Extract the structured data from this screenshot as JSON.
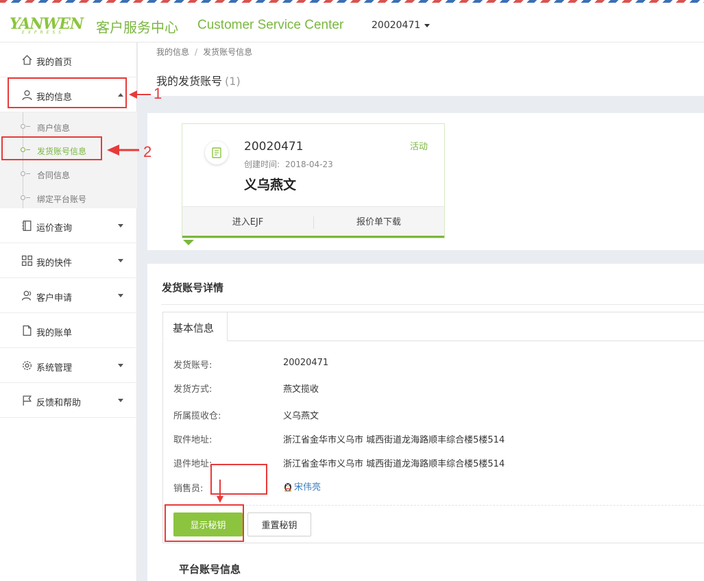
{
  "colors": {
    "brand_green": "#7ab73f",
    "button_green": "#8cc43f",
    "annotation_red": "#e83a3a",
    "link_blue": "#3b7dbf"
  },
  "header": {
    "logo_text": "YANWEN",
    "logo_subtext": "EXPRESS",
    "title_cn": "客户服务中心",
    "title_en": "Customer Service Center",
    "account_dropdown": "20020471"
  },
  "sidebar": {
    "items": [
      {
        "label": "我的首页",
        "icon": "home-icon"
      },
      {
        "label": "我的信息",
        "icon": "user-icon",
        "expanded": true
      },
      {
        "label": "运价查询",
        "icon": "notebook-icon"
      },
      {
        "label": "我的快件",
        "icon": "grid-icon"
      },
      {
        "label": "客户申请",
        "icon": "users-icon"
      },
      {
        "label": "我的账单",
        "icon": "document-icon"
      },
      {
        "label": "系统管理",
        "icon": "gear-icon"
      },
      {
        "label": "反馈和帮助",
        "icon": "flag-icon"
      }
    ],
    "submenu": [
      {
        "label": "商户信息"
      },
      {
        "label": "发货账号信息",
        "active": true
      },
      {
        "label": "合同信息"
      },
      {
        "label": "绑定平台账号"
      }
    ]
  },
  "breadcrumb": {
    "parent": "我的信息",
    "separator": "/",
    "current": "发货账号信息"
  },
  "page_title": {
    "text": "我的发货账号",
    "count": "(1)"
  },
  "account_card": {
    "number": "20020471",
    "status": "活动",
    "created_label": "创建时间:",
    "created_value": "2018-04-23",
    "name": "义乌燕文",
    "action_enter": "进入EJF",
    "action_download": "报价单下载"
  },
  "detail": {
    "title": "发货账号详情",
    "tab": "基本信息",
    "rows": [
      {
        "label": "发货账号:",
        "value": "20020471"
      },
      {
        "label": "发货方式:",
        "value": "燕文揽收"
      },
      {
        "label": "所属揽收仓:",
        "value": "义乌燕文"
      },
      {
        "label": "取件地址:",
        "value": "浙江省金华市义乌市 城西街道龙海路顺丰综合楼5楼514"
      },
      {
        "label": "退件地址:",
        "value": "浙江省金华市义乌市 城西街道龙海路顺丰综合楼5楼514"
      },
      {
        "label": "销售员:",
        "value": "宋伟亮"
      }
    ],
    "show_key_button": "显示秘钥",
    "reset_key_button": "重置秘钥"
  },
  "platform_section": {
    "title": "平台账号信息"
  },
  "annotations": {
    "step1": "1",
    "step2": "2"
  }
}
